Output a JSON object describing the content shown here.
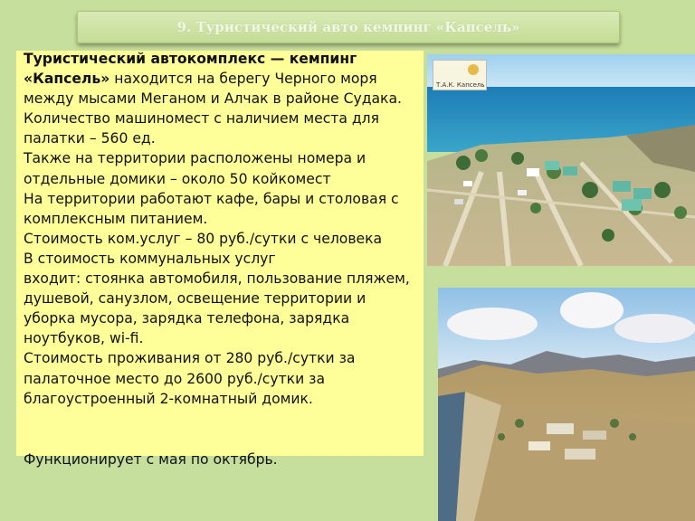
{
  "header": {
    "title": "9. Туристический авто кемпинг «Капсель»"
  },
  "content": {
    "lead_bold": "Туристический автокомплекс — кемпинг «Капсель»",
    "lead_rest": " находится на берегу Черного моря между мысами Меганом и Алчак в районе Судака. Количество машиномест с наличием места для палатки – 560 ед.",
    "paragraphs": [
      "Также на территории расположены номера и отдельные домики – около 50 койкомест",
      "На территории работают кафе, бары и столовая с комплексным питанием.",
      "Стоимость ком.услуг – 80 руб./сутки с человека",
      "В стоимость коммунальных услуг",
      "входит: стоянка автомобиля, пользование пляжем, душевой, санузлом, освещение территории и уборка мусора, зарядка телефона, зарядка ноутбуков, wi-fi.",
      "Стоимость проживания от 280 руб./сутки за палаточное место до 2600 руб./сутки за благоустроенный 2-комнатный домик."
    ],
    "footer": "Функционирует с мая по октябрь."
  },
  "photos": {
    "logo_text": "Т.А.К. Капсель"
  },
  "colors": {
    "background": "#c7df9c",
    "panel": "#ffff99",
    "title_bar": "#c9e09c"
  }
}
